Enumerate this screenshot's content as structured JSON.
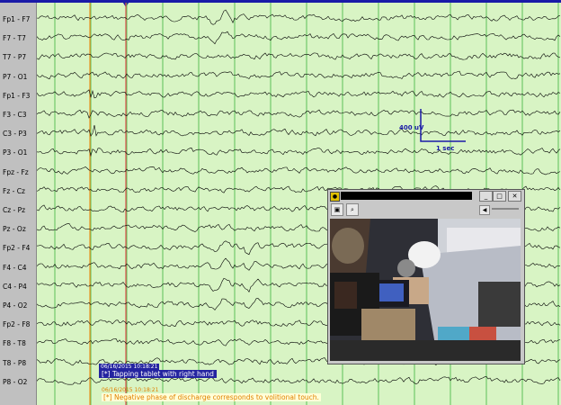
{
  "channels": [
    "Fp1 - F7",
    "F7 - T7",
    "T7 - P7",
    "P7 - O1",
    "Fp1 - F3",
    "F3 - C3",
    "C3 - P3",
    "P3 - O1",
    "Fpz - Fz",
    "Fz - Cz",
    "Cz - Pz",
    "Pz - Oz",
    "Fp2 - F4",
    "F4 - C4",
    "C4 - P4",
    "P4 - O2",
    "Fp2 - F8",
    "F8 - T8",
    "T8 - P8",
    "P8 - O2"
  ],
  "calibration": {
    "amplitude": "400 uV",
    "time": "1 sec"
  },
  "video_window": {
    "controls": {
      "minimize": "_",
      "maximize": "□",
      "close": "✕"
    },
    "toolbar_icons": [
      "camera-icon",
      "zoom-icon"
    ],
    "volume_icon": "speaker-icon"
  },
  "annotations": [
    {
      "timestamp": "06/16/2015 10:18:21",
      "text": "[*] Tapping tablet with right hand",
      "color": "#2424a0"
    },
    {
      "timestamp": "06/16/2015 10:18:21",
      "text": "[*] Negative phase of discharge corresponds to volitional touch.",
      "color": "#e08000"
    }
  ],
  "colors": {
    "background": "#d8f4c4",
    "trace": "#000000",
    "gridline": "#3cb43c",
    "marker_orange": "#f09020",
    "marker_red": "#e05050",
    "accent_blue": "#1a1aa8"
  }
}
